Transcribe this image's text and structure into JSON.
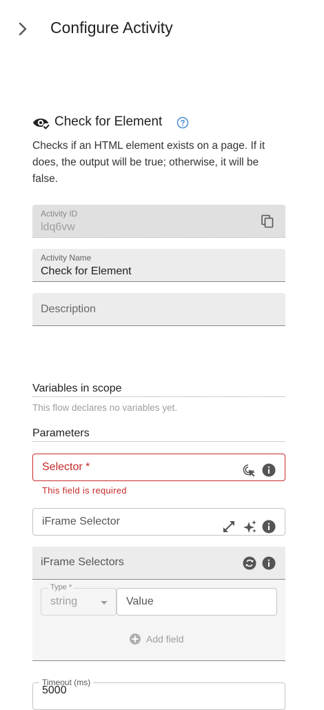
{
  "header": {
    "title": "Configure Activity"
  },
  "activity": {
    "title": "Check for Element",
    "description": "Checks if an HTML element exists on a page. If it does, the output will be true; otherwise, it will be false."
  },
  "fields": {
    "activity_id": {
      "label": "Activity ID",
      "value": "ldq6vw"
    },
    "activity_name": {
      "label": "Activity Name",
      "value": "Check for Element"
    },
    "description": {
      "placeholder": "Description"
    }
  },
  "variables": {
    "title": "Variables in scope",
    "empty_text": "This flow declares no variables yet."
  },
  "parameters": {
    "title": "Parameters",
    "selector": {
      "label": "Selector *",
      "error": "This field is required"
    },
    "iframe_selector": {
      "label": "iFrame Selector"
    },
    "iframe_selectors": {
      "title": "iFrame Selectors",
      "type_label": "Type *",
      "type_value": "string",
      "value_placeholder": "Value",
      "add_field": "Add field"
    },
    "timeout": {
      "label": "Timeout (ms)",
      "value": "5000"
    }
  },
  "colors": {
    "error": "#c62828",
    "accent": "#1976d2",
    "field_bg": "#ececec"
  }
}
